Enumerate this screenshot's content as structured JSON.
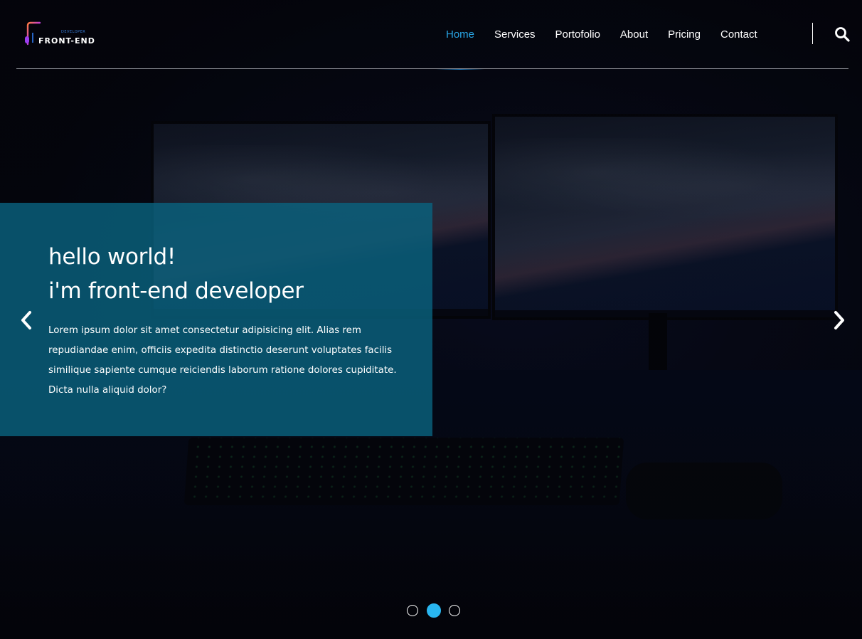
{
  "logo": {
    "brand": "FRONT-END",
    "tagline": "DEVELOPER",
    "icon": "front-end-logo-icon"
  },
  "nav": {
    "items": [
      {
        "label": "Home",
        "active": true
      },
      {
        "label": "Services",
        "active": false
      },
      {
        "label": "Portofolio",
        "active": false
      },
      {
        "label": "About",
        "active": false
      },
      {
        "label": "Pricing",
        "active": false
      },
      {
        "label": "Contact",
        "active": false
      }
    ],
    "search_icon": "search-icon"
  },
  "hero": {
    "title_line1": "hello world!",
    "title_line2": "i'm front-end developer",
    "body": "Lorem ipsum dolor sit amet consectetur adipisicing elit. Alias rem repudiandae enim, officiis expedita distinctio deserunt voluptates facilis similique sapiente cumque reiciendis laborum ratione dolores cupiditate. Dicta nulla aliquid dolor?"
  },
  "carousel": {
    "prev_icon": "chevron-left-icon",
    "next_icon": "chevron-right-icon",
    "slide_count": 3,
    "active_index": 1
  },
  "colors": {
    "accent": "#29a6e6",
    "hero_panel": "#0a627e",
    "dot_active": "#29b6f0",
    "background": "#05060d"
  }
}
